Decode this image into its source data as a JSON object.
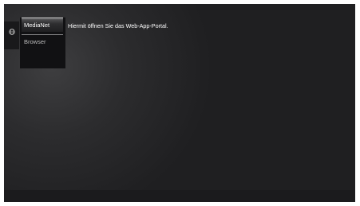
{
  "menu": {
    "items": [
      {
        "label": "MediaNet",
        "selected": true
      },
      {
        "label": "Browser",
        "selected": false
      }
    ]
  },
  "tooltip": {
    "text": "Hiermit öffnen Sie das Web-App-Portal."
  },
  "side_tab": {
    "icon": "globe-icon"
  },
  "colors": {
    "background": "#2c2c2e",
    "menu_panel": "#111113",
    "selected_item": "#48484a",
    "text": "#ffffff"
  }
}
